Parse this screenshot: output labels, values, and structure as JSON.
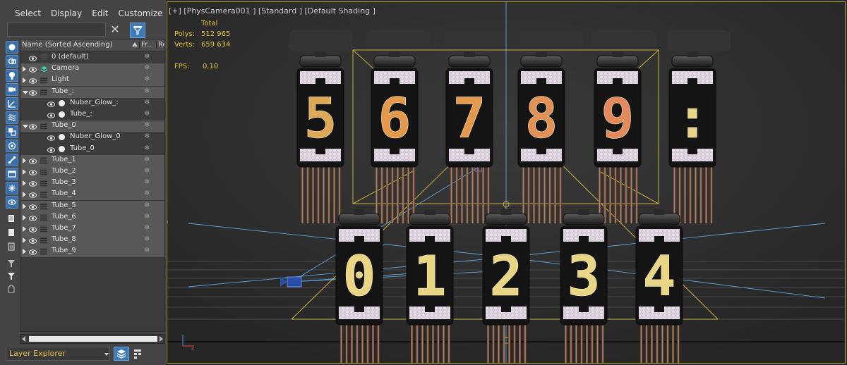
{
  "menu": {
    "select": "Select",
    "display": "Display",
    "edit": "Edit",
    "customize": "Customize"
  },
  "search": {
    "placeholder": ""
  },
  "columns": {
    "name": "Name (Sorted Ascending)",
    "frozen": "Fr...",
    "render": "Re"
  },
  "tree": [
    {
      "label": "0 (default)",
      "icon": "layer-icon",
      "indent": 0,
      "expander": "none",
      "selected": false
    },
    {
      "label": "Camera",
      "icon": "camera-icon",
      "indent": 0,
      "expander": "closed",
      "selected": true
    },
    {
      "label": "Light",
      "icon": "layer-icon",
      "indent": 0,
      "expander": "closed",
      "selected": true
    },
    {
      "label": "Tube_:",
      "icon": "layer-icon",
      "indent": 0,
      "expander": "open",
      "selected": true
    },
    {
      "label": "Nuber_Glow_:",
      "icon": "sphere-icon",
      "indent": 1,
      "expander": "none",
      "selected": false
    },
    {
      "label": "Tube_:",
      "icon": "sphere-icon",
      "indent": 1,
      "expander": "none",
      "selected": false
    },
    {
      "label": "Tube_0",
      "icon": "layer-icon",
      "indent": 0,
      "expander": "open",
      "selected": true
    },
    {
      "label": "Nuber_Glow_0",
      "icon": "sphere-icon",
      "indent": 1,
      "expander": "none",
      "selected": false
    },
    {
      "label": "Tube_0",
      "icon": "sphere-icon",
      "indent": 1,
      "expander": "none",
      "selected": false
    },
    {
      "label": "Tube_1",
      "icon": "layer-icon",
      "indent": 0,
      "expander": "closed",
      "selected": true
    },
    {
      "label": "Tube_2",
      "icon": "layer-icon",
      "indent": 0,
      "expander": "closed",
      "selected": true
    },
    {
      "label": "Tube_3",
      "icon": "layer-icon",
      "indent": 0,
      "expander": "closed",
      "selected": true
    },
    {
      "label": "Tube_4",
      "icon": "layer-icon",
      "indent": 0,
      "expander": "closed",
      "selected": true
    },
    {
      "label": "Tube_5",
      "icon": "layer-icon",
      "indent": 0,
      "expander": "closed",
      "selected": true
    },
    {
      "label": "Tube_6",
      "icon": "layer-icon",
      "indent": 0,
      "expander": "closed",
      "selected": true
    },
    {
      "label": "Tube_7",
      "icon": "layer-icon",
      "indent": 0,
      "expander": "closed",
      "selected": true
    },
    {
      "label": "Tube_8",
      "icon": "layer-icon",
      "indent": 0,
      "expander": "closed",
      "selected": true
    },
    {
      "label": "Tube_9",
      "icon": "layer-icon",
      "indent": 0,
      "expander": "closed",
      "selected": true
    }
  ],
  "footer": {
    "layer_explorer": "Layer Explorer"
  },
  "viewport": {
    "label": "[+] [PhysCamera001 ] [Standard ] [Default Shading ]",
    "stats": {
      "total": "Total",
      "polys_label": "Polys:",
      "polys_value": "512 965",
      "verts_label": "Verts:",
      "verts_value": "659 634",
      "fps_label": "FPS:",
      "fps_value": "0,10"
    },
    "top_row_digits": [
      "5",
      "6",
      "7",
      "8",
      "9",
      ":"
    ],
    "bottom_row_digits": [
      "0",
      "1",
      "2",
      "3",
      "4"
    ]
  },
  "colors": {
    "accent_blue": "#3d78b7",
    "selection_yellow": "#e2c23b",
    "glow_orange": "#f0a050",
    "glow_yellow": "#f5e08a"
  }
}
